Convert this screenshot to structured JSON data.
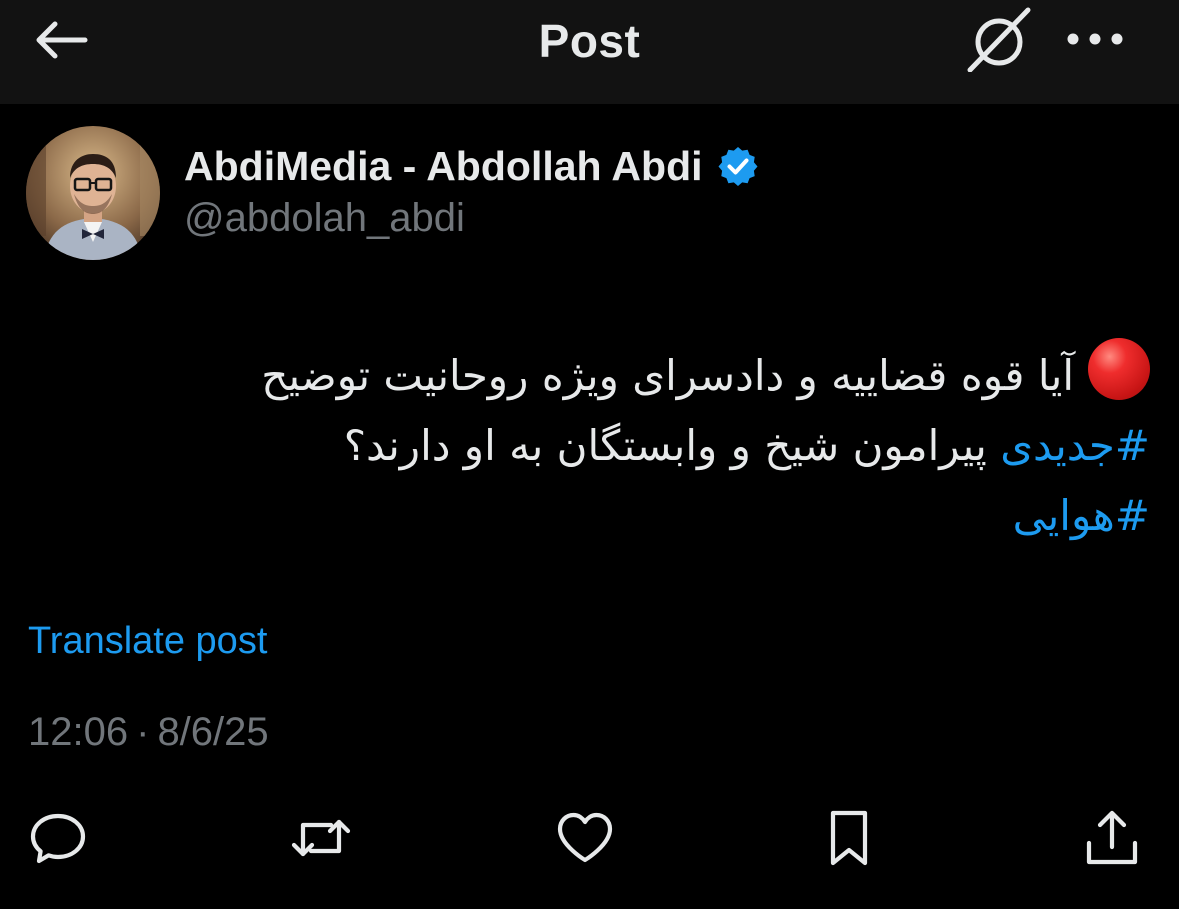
{
  "header": {
    "title": "Post",
    "back_icon": "arrow-left-icon",
    "grok_icon": "grok-icon",
    "more_icon": "more-horizontal-icon"
  },
  "author": {
    "display_name": "AbdiMedia - Abdollah Abdi",
    "handle": "@abdolah_abdi",
    "verified": true,
    "verified_color": "#1d9bf0"
  },
  "post": {
    "lines": [
      [
        "آیا قوه قضاییه و دادسرای ویژه روحانیت توضیح"
      ],
      [
        "#جدیدی",
        " پیرامون شیخ و وابستگان به او دارند؟"
      ],
      [
        "#هوایی"
      ]
    ],
    "hashtags": [
      "#جدیدی",
      "#هوایی"
    ],
    "translate_label": "Translate post",
    "time": "12:06",
    "date": "8/6/25"
  },
  "actions": {
    "reply": "reply-icon",
    "repost": "repost-icon",
    "like": "like-icon",
    "bookmark": "bookmark-icon",
    "share": "share-icon"
  },
  "colors": {
    "background": "#000000",
    "header_background": "#121212",
    "text": "#e7e9ea",
    "secondary_text": "#71767b",
    "accent": "#1d9bf0"
  }
}
